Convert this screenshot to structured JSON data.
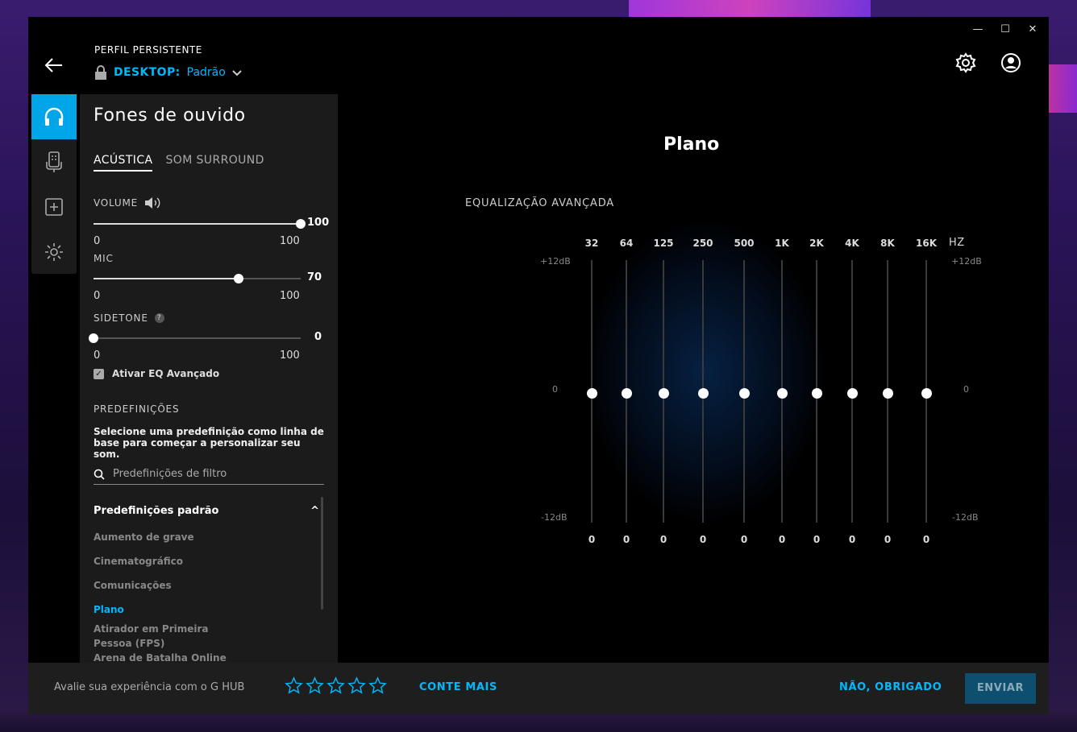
{
  "profile": {
    "label": "PERFIL PERSISTENTE",
    "device": "DESKTOP:",
    "name": "Padrão"
  },
  "window_controls": {
    "minimize": "—",
    "maximize": "☐",
    "close": "✕"
  },
  "panel": {
    "title": "Fones de ouvido",
    "tabs": [
      "ACÚSTICA",
      "SOM SURROUND"
    ],
    "active_tab": 0
  },
  "sliders": {
    "volume": {
      "label": "VOLUME",
      "value": 100,
      "value_text": "100",
      "min": "0",
      "max": "100"
    },
    "mic": {
      "label": "MIC",
      "value": 70,
      "value_text": "70",
      "min": "0",
      "max": "100"
    },
    "sidetone": {
      "label": "SIDETONE",
      "value": 0,
      "value_text": "0",
      "min": "0",
      "max": "100",
      "help": "?"
    }
  },
  "advanced_eq_checkbox": {
    "label": "Ativar EQ Avançado",
    "checked": true,
    "mark": "✓"
  },
  "presets": {
    "heading": "PREDEFINIÇÕES",
    "description": "Selecione uma predefinição como linha de base para começar a personalizar seu som.",
    "search_placeholder": "Predefinições de filtro",
    "group_title": "Predefinições padrão",
    "group_toggle": "^",
    "items": [
      "Aumento de grave",
      "Cinematográfico",
      "Comunicações",
      "Plano",
      "Atirador em Primeira Pessoa (FPS)",
      "Arena de Batalha Online"
    ],
    "active_index": 3
  },
  "main": {
    "title": "Plano",
    "eq_heading": "EQUALIZAÇÃO AVANÇADA",
    "hz_label": "HZ",
    "db_top": "+12dB",
    "db_zero": "0",
    "db_bottom": "-12dB",
    "bands": [
      {
        "freq": "32",
        "gain": 0,
        "gain_text": "0"
      },
      {
        "freq": "64",
        "gain": 0,
        "gain_text": "0"
      },
      {
        "freq": "125",
        "gain": 0,
        "gain_text": "0"
      },
      {
        "freq": "250",
        "gain": 0,
        "gain_text": "0"
      },
      {
        "freq": "500",
        "gain": 0,
        "gain_text": "0"
      },
      {
        "freq": "1K",
        "gain": 0,
        "gain_text": "0"
      },
      {
        "freq": "2K",
        "gain": 0,
        "gain_text": "0"
      },
      {
        "freq": "4K",
        "gain": 0,
        "gain_text": "0"
      },
      {
        "freq": "8K",
        "gain": 0,
        "gain_text": "0"
      },
      {
        "freq": "16K",
        "gain": 0,
        "gain_text": "0"
      }
    ]
  },
  "footer": {
    "prompt": "Avalie sua experiência com o G HUB",
    "star_count": 5,
    "tell_more": "CONTE MAIS",
    "no_thanks": "NÃO, OBRIGADO",
    "send": "ENVIAR"
  },
  "colors": {
    "accent": "#00b8fc",
    "panel_bg": "#1b1b1b",
    "rail_active": "#00a6e8"
  }
}
